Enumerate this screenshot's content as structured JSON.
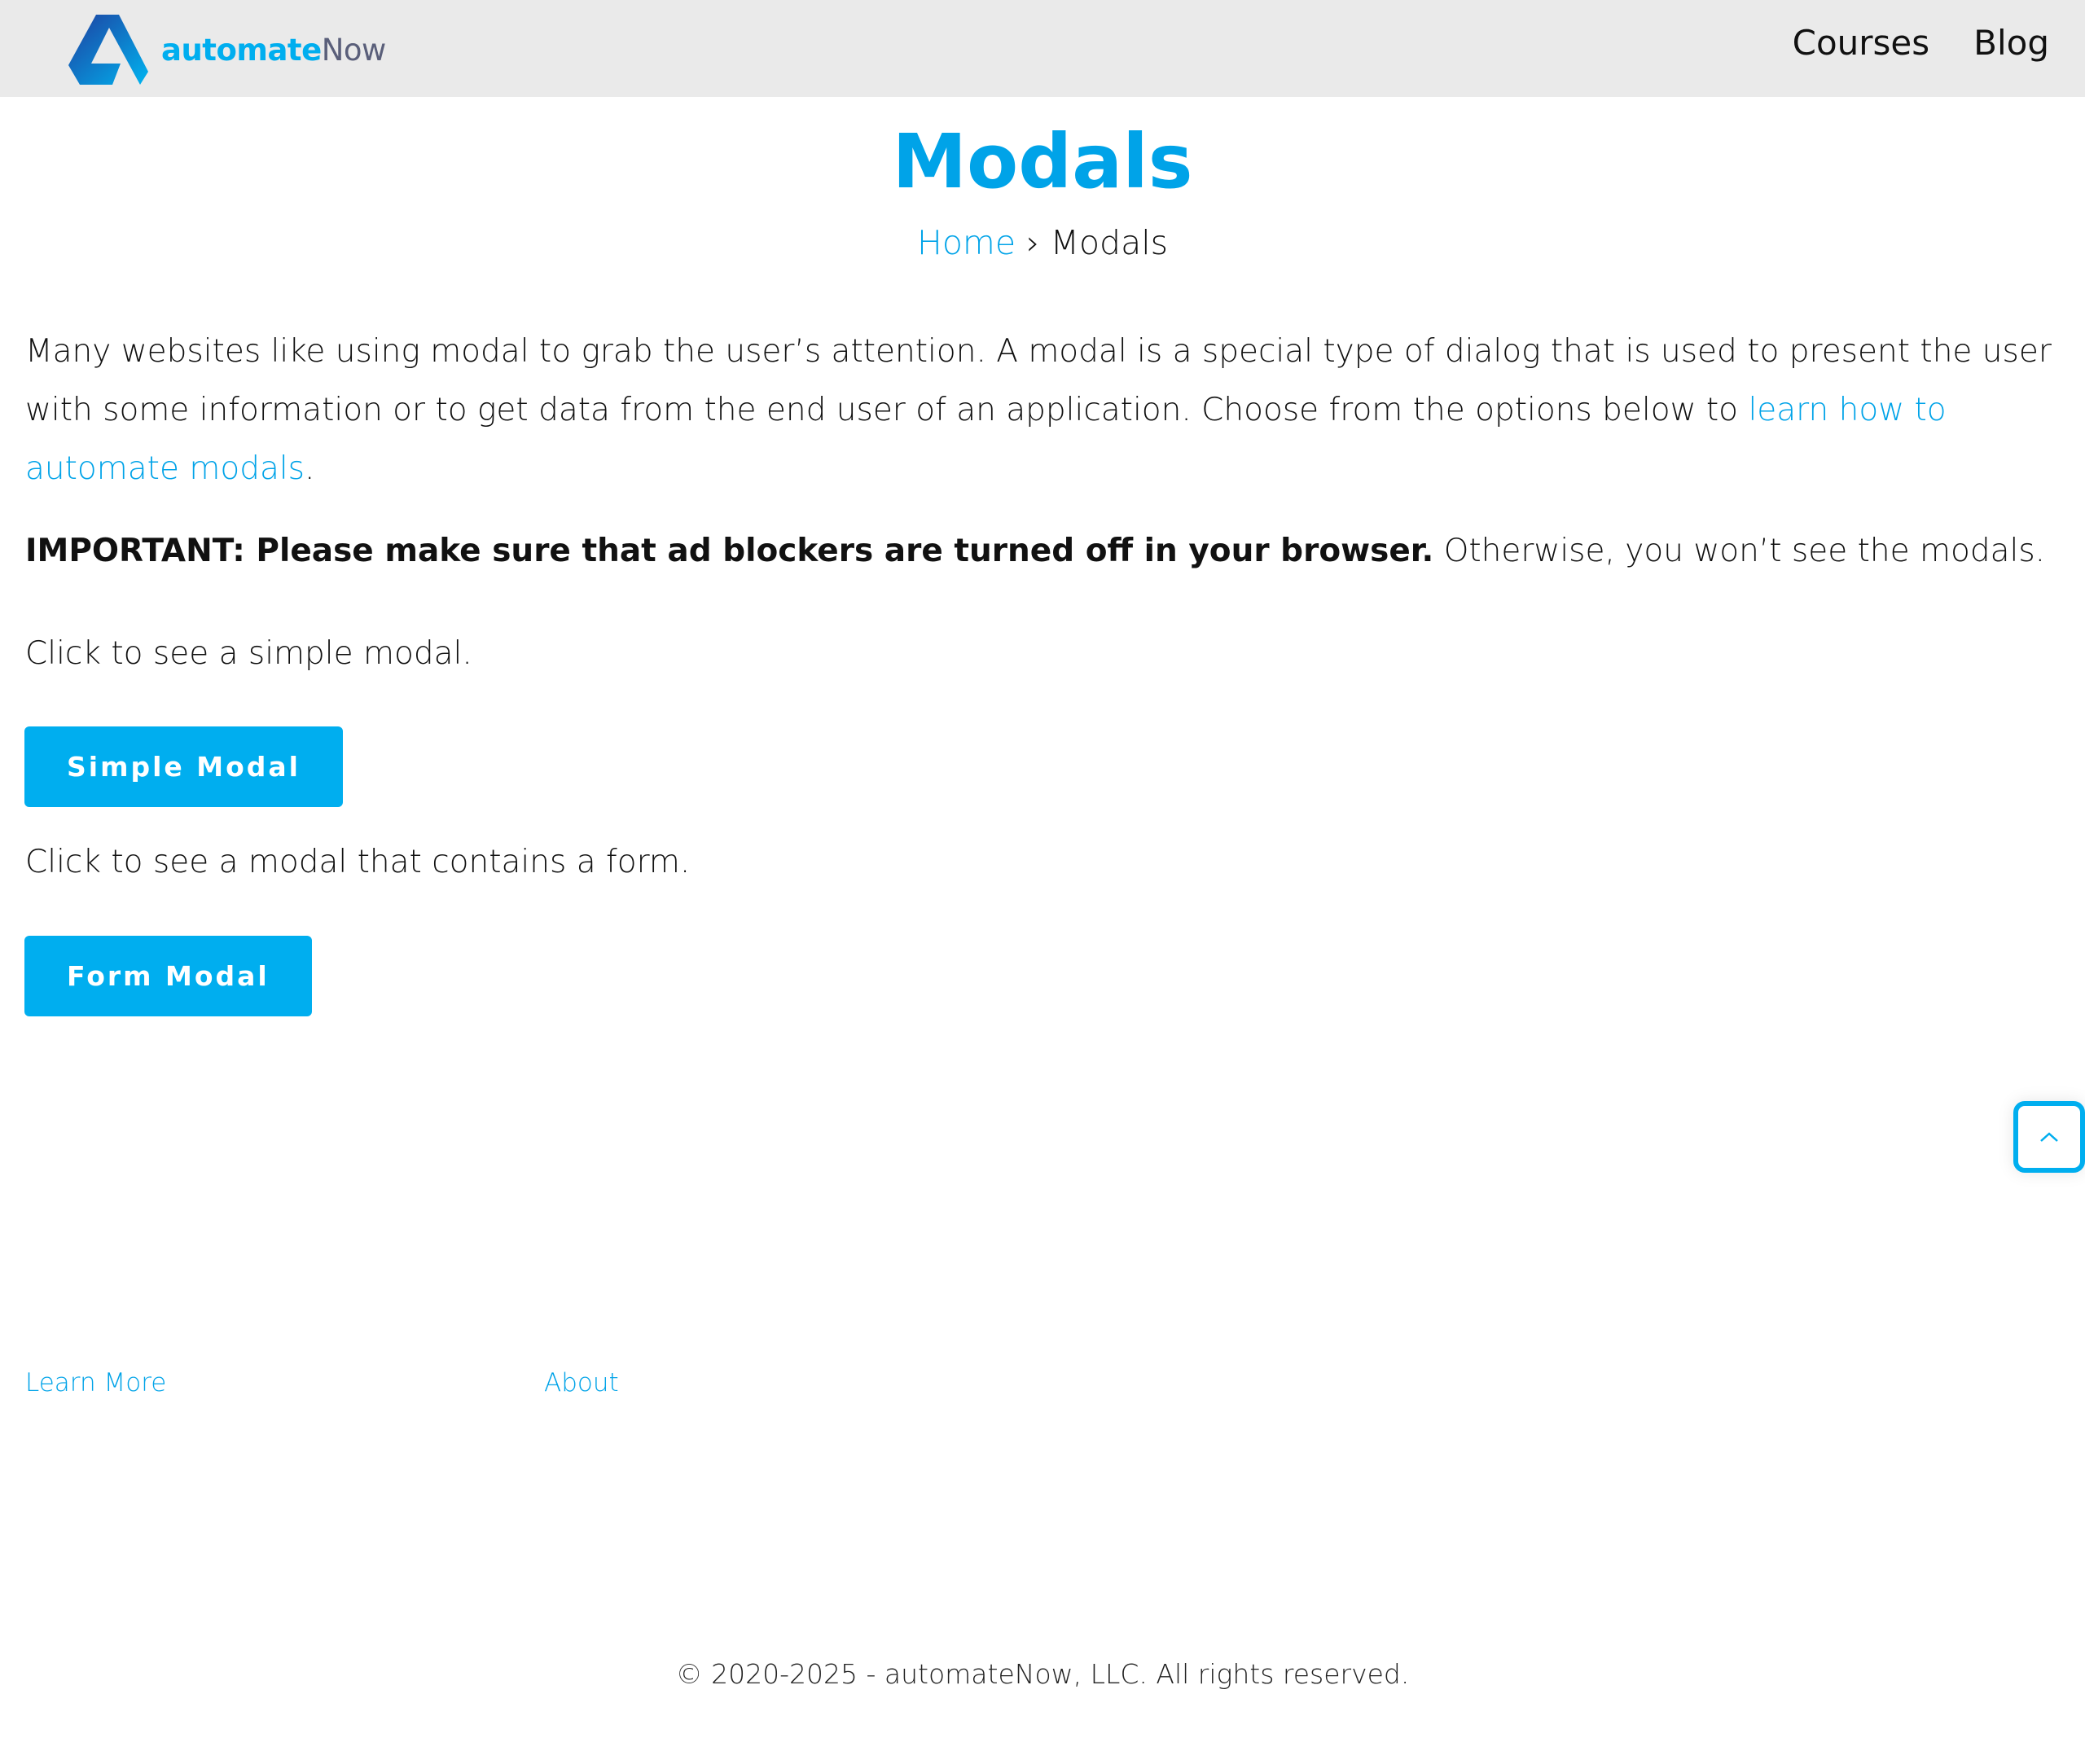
{
  "header": {
    "logo_primary": "automate",
    "logo_secondary": "Now",
    "nav": [
      "Courses",
      "Blog"
    ]
  },
  "page": {
    "title": "Modals",
    "breadcrumb": {
      "home": "Home",
      "separator": "›",
      "current": "Modals"
    }
  },
  "content": {
    "intro_text": "Many websites like using modal to grab the user’s attention. A modal is a special type of dialog that is used to present the user with some information or to get data from the end user of an application. Choose from the options below to ",
    "intro_link": "learn how to automate modals",
    "intro_end": ".",
    "important_bold": "IMPORTANT: Please make sure that ad blockers are turned off in your browser.",
    "important_rest": " Otherwise, you won’t see the modals.",
    "simple_text": "Click to see a simple modal.",
    "simple_button": "Simple Modal",
    "form_text": "Click to see a modal that contains a form.",
    "form_button": "Form Modal"
  },
  "footer": {
    "links": [
      "Learn More",
      "About"
    ],
    "copyright": "© 2020-2025 - automateNow, LLC. All rights reserved."
  },
  "colors": {
    "accent": "#00aeef",
    "header_bg": "#eaeaea"
  },
  "icons": {
    "scroll_top": "chevron-up-icon"
  }
}
